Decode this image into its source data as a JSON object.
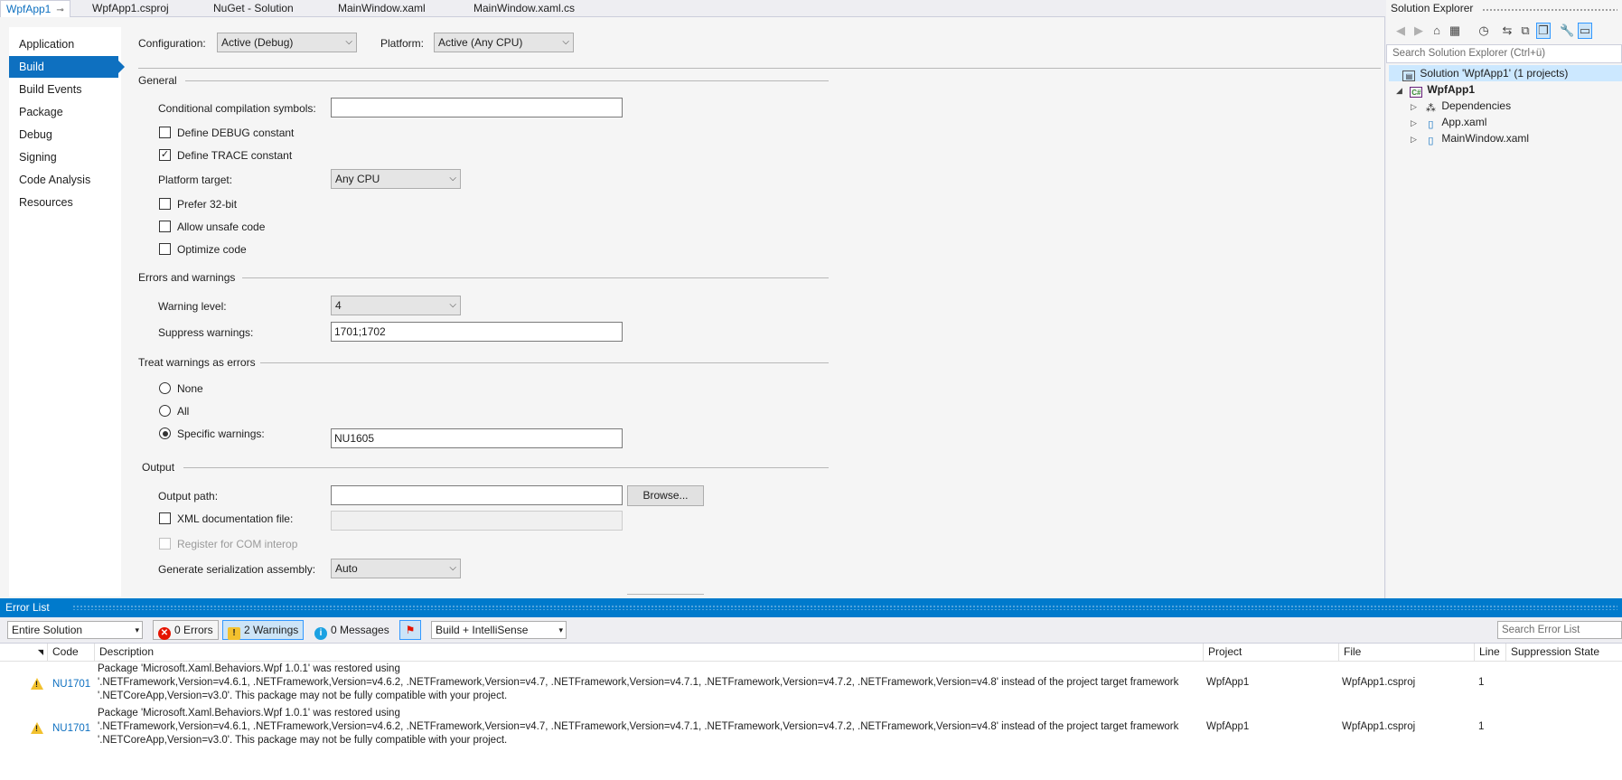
{
  "doc_tabs": [
    {
      "label": "WpfApp1",
      "active": true
    },
    {
      "label": "WpfApp1.csproj",
      "active": false
    },
    {
      "label": "NuGet - Solution",
      "active": false
    },
    {
      "label": "MainWindow.xaml",
      "active": false
    },
    {
      "label": "MainWindow.xaml.cs",
      "active": false
    }
  ],
  "nav": {
    "items": [
      "Application",
      "Build",
      "Build Events",
      "Package",
      "Debug",
      "Signing",
      "Code Analysis",
      "Resources"
    ],
    "selected": "Build"
  },
  "config": {
    "configuration_label": "Configuration:",
    "configuration_value": "Active (Debug)",
    "platform_label": "Platform:",
    "platform_value": "Active (Any CPU)"
  },
  "general": {
    "title": "General",
    "symbols_label": "Conditional compilation symbols:",
    "symbols_value": "",
    "define_debug": {
      "label": "Define DEBUG constant",
      "checked": false
    },
    "define_trace": {
      "label": "Define TRACE constant",
      "checked": true
    },
    "platform_target_label": "Platform target:",
    "platform_target_value": "Any CPU",
    "prefer32": {
      "label": "Prefer 32-bit",
      "checked": false
    },
    "unsafe": {
      "label": "Allow unsafe code",
      "checked": false
    },
    "optimize": {
      "label": "Optimize code",
      "checked": false
    }
  },
  "errors_warnings": {
    "title": "Errors and warnings",
    "warning_level_label": "Warning level:",
    "warning_level_value": "4",
    "suppress_label": "Suppress warnings:",
    "suppress_value": "1701;1702"
  },
  "treat_warnings": {
    "title": "Treat warnings as errors",
    "none_label": "None",
    "all_label": "All",
    "specific_label": "Specific warnings:",
    "specific_value": "NU1605",
    "selected": "specific"
  },
  "output": {
    "title": "Output",
    "path_label": "Output path:",
    "path_value": "",
    "browse_label": "Browse...",
    "xml_doc": {
      "label": "XML documentation file:",
      "checked": false
    },
    "xml_doc_value": "",
    "com_interop": {
      "label": "Register for COM interop",
      "checked": false,
      "enabled": false
    },
    "serialization_label": "Generate serialization assembly:",
    "serialization_value": "Auto"
  },
  "solution_explorer": {
    "title": "Solution Explorer",
    "search_placeholder": "Search Solution Explorer (Ctrl+ü)",
    "solution_label": "Solution 'WpfApp1' (1 projects)",
    "project_label": "WpfApp1",
    "project_icon_text": "C#",
    "items": [
      "Dependencies",
      "App.xaml",
      "MainWindow.xaml"
    ]
  },
  "error_list": {
    "title": "Error List",
    "scope": "Entire Solution",
    "errors_label": "0 Errors",
    "warnings_label": "2 Warnings",
    "messages_label": "0 Messages",
    "build_filter": "Build + IntelliSense",
    "search_placeholder": "Search Error List",
    "columns": [
      "Code",
      "Description",
      "Project",
      "File",
      "Line",
      "Suppression State"
    ],
    "rows": [
      {
        "code": "NU1701",
        "desc_line1": "Package 'Microsoft.Xaml.Behaviors.Wpf 1.0.1' was restored using",
        "desc_line2": "'.NETFramework,Version=v4.6.1, .NETFramework,Version=v4.6.2, .NETFramework,Version=v4.7, .NETFramework,Version=v4.7.1, .NETFramework,Version=v4.7.2, .NETFramework,Version=v4.8' instead of the project target framework",
        "desc_line3": "'.NETCoreApp,Version=v3.0'. This package may not be fully compatible with your project.",
        "project": "WpfApp1",
        "file": "WpfApp1.csproj",
        "line": "1",
        "suppression": ""
      },
      {
        "code": "NU1701",
        "desc_line1": "Package 'Microsoft.Xaml.Behaviors.Wpf 1.0.1' was restored using",
        "desc_line2": "'.NETFramework,Version=v4.6.1, .NETFramework,Version=v4.6.2, .NETFramework,Version=v4.7, .NETFramework,Version=v4.7.1, .NETFramework,Version=v4.7.2, .NETFramework,Version=v4.8' instead of the project target framework",
        "desc_line3": "'.NETCoreApp,Version=v3.0'. This package may not be fully compatible with your project.",
        "project": "WpfApp1",
        "file": "WpfApp1.csproj",
        "line": "1",
        "suppression": ""
      }
    ]
  },
  "colors": {
    "accent": "#0e70c0",
    "tool_window_header": "#007acc",
    "warning": "#f2c12e",
    "error": "#e51400",
    "info": "#1ba1e2"
  }
}
